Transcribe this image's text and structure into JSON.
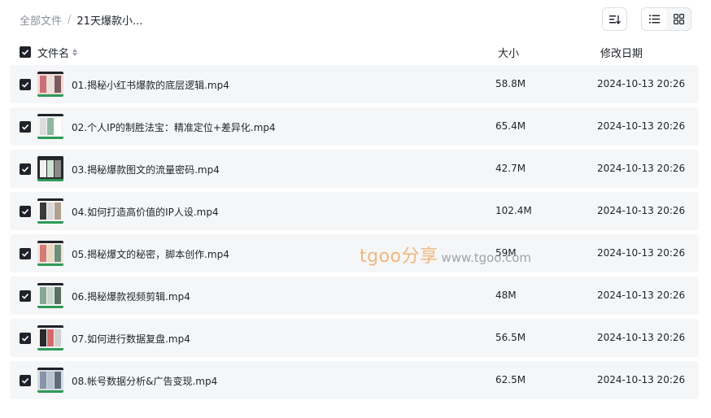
{
  "breadcrumb": {
    "root": "全部文件",
    "separator": "/",
    "current": "21天爆款小..."
  },
  "toolbar": {
    "sort_icon": "sort-lines-icon",
    "views": [
      {
        "icon": "list-view-icon",
        "active": true
      },
      {
        "icon": "grid-view-icon",
        "active": false
      }
    ]
  },
  "table": {
    "columns": {
      "name": "文件名",
      "size": "大小",
      "date": "修改日期"
    },
    "rows": [
      {
        "name": "01.揭秘小红书爆款的底层逻辑.mp4",
        "size": "58.8M",
        "date": "2024-10-13 20:26",
        "thumb": 0
      },
      {
        "name": "02.个人IP的制胜法宝：精准定位+差异化.mp4",
        "size": "65.4M",
        "date": "2024-10-13 20:26",
        "thumb": 1
      },
      {
        "name": "03.揭秘爆款图文的流量密码.mp4",
        "size": "42.7M",
        "date": "2024-10-13 20:26",
        "thumb": 2
      },
      {
        "name": "04.如何打造高价值的IP人设.mp4",
        "size": "102.4M",
        "date": "2024-10-13 20:26",
        "thumb": 3
      },
      {
        "name": "05.揭秘爆文的秘密，脚本创作.mp4",
        "size": "59M",
        "date": "2024-10-13 20:26",
        "thumb": 4
      },
      {
        "name": "06.揭秘爆款视频剪辑.mp4",
        "size": "48M",
        "date": "2024-10-13 20:26",
        "thumb": 5
      },
      {
        "name": "07.如何进行数据复盘.mp4",
        "size": "56.5M",
        "date": "2024-10-13 20:26",
        "thumb": 6
      },
      {
        "name": "08.帐号数据分析&广告变现.mp4",
        "size": "62.5M",
        "date": "2024-10-13 20:26",
        "thumb": 7
      }
    ]
  },
  "watermark": {
    "main": "tgoo分享",
    "url": "www.tgoo.com"
  },
  "colors": {
    "row_bg": "#f5f6f7",
    "checkbox": "#1f2329",
    "watermark": "#f0a860",
    "thumb_green": "#2e9a58"
  }
}
